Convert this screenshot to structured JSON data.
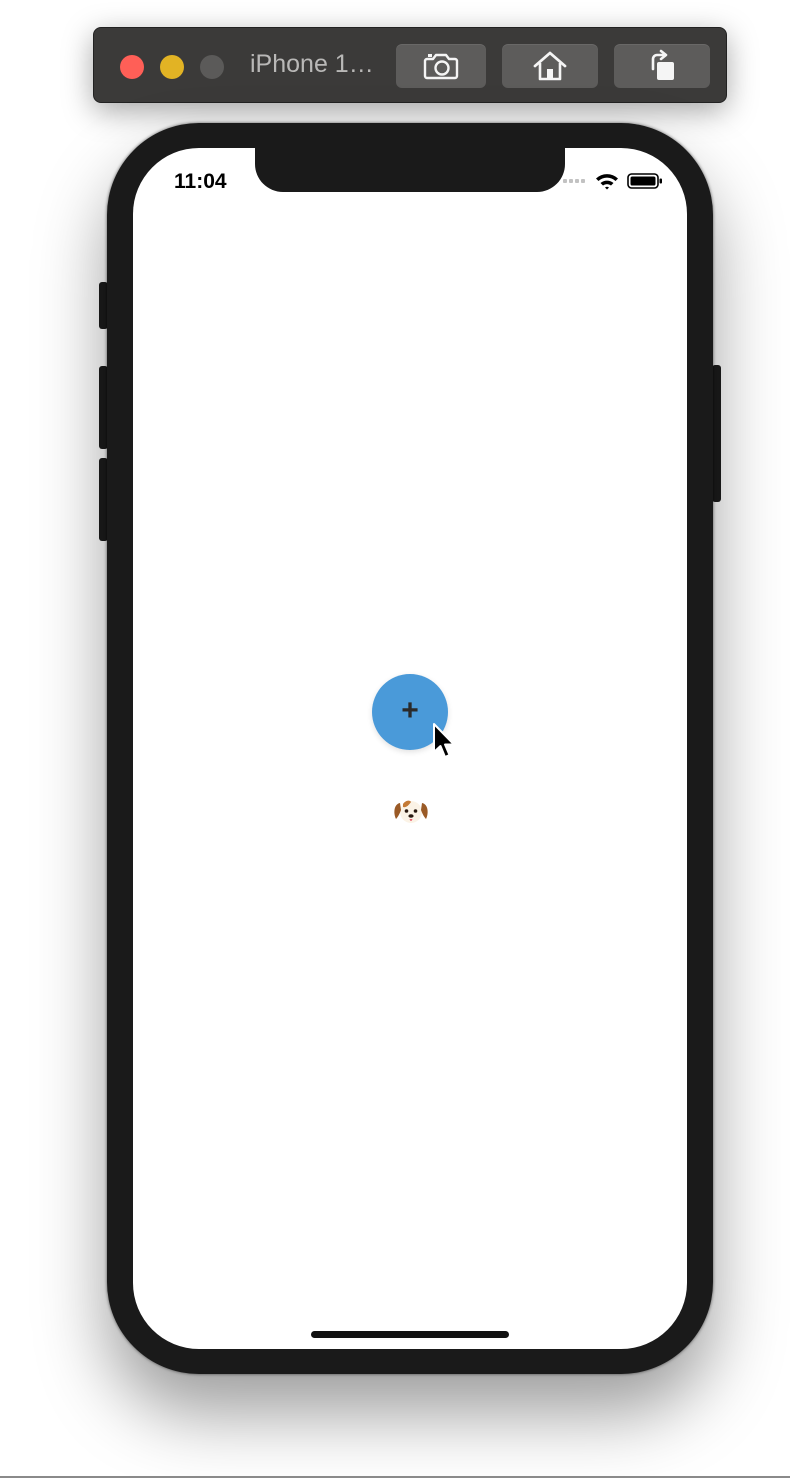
{
  "window": {
    "title": "iPhone 1…"
  },
  "toolbar": {
    "screenshot_icon": "camera-icon",
    "home_icon": "home-icon",
    "rotate_icon": "rotate-icon"
  },
  "status_bar": {
    "time": "11:04",
    "signal_icon": "signal-icon",
    "wifi_icon": "wifi-icon",
    "battery_icon": "battery-icon"
  },
  "screen": {
    "fab_label": "+",
    "fab_color": "#4a9ad9",
    "pet_emoji": "dog-face-icon"
  },
  "colors": {
    "close": "#ff5f57",
    "minimize": "#e2b324",
    "zoom_disabled": "#5b5a59",
    "toolbar_bg": "#3b3a39"
  }
}
